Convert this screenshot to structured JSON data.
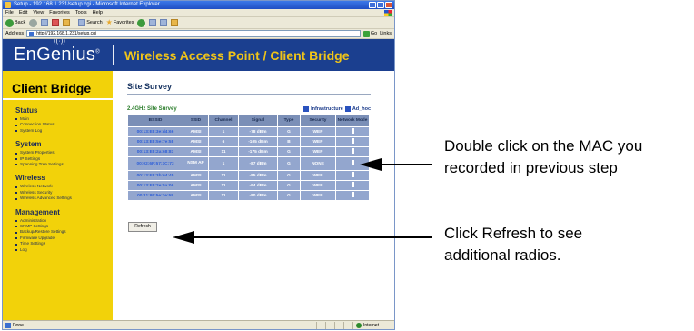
{
  "browser": {
    "title": "Setup - 192.168.1.231/setup.cgi - Microsoft Internet Explorer",
    "menu": [
      "File",
      "Edit",
      "View",
      "Favorites",
      "Tools",
      "Help"
    ],
    "toolbar": {
      "back": "Back",
      "search": "Search",
      "favorites": "Favorites"
    },
    "address_label": "Address",
    "address_value": "http://192.168.1.231/setup.cgi",
    "go_label": "Go",
    "links_label": "Links"
  },
  "header": {
    "brand": "EnGenius",
    "title": "Wireless Access Point / Client Bridge"
  },
  "sidebar": {
    "heading": "Client Bridge",
    "groups": [
      {
        "title": "Status",
        "items": [
          "Main",
          "Connection Status",
          "System Log"
        ]
      },
      {
        "title": "System",
        "items": [
          "System Properties",
          "IP Settings",
          "Spanning Tree Settings"
        ]
      },
      {
        "title": "Wireless",
        "items": [
          "Wireless Network",
          "Wireless Security",
          "Wireless Advanced Settings"
        ]
      },
      {
        "title": "Management",
        "items": [
          "Administration",
          "SNMP Settings",
          "Backup/Restore Settings",
          "Firmware Upgrade",
          "Time Settings",
          "Log"
        ]
      }
    ]
  },
  "main": {
    "title": "Site Survey",
    "survey_label": "2.4GHz Site Survey",
    "legend_infra": "Infrastructure",
    "legend_adhoc": "Ad_hoc",
    "columns": [
      "BSSID",
      "SSID",
      "Channel",
      "Signal",
      "Type",
      "Security",
      "Network Mode"
    ],
    "rows": [
      [
        "00:13:E8:3e:d4:66",
        "AMSI",
        "1",
        "-78 dBm",
        "G",
        "WEP",
        ""
      ],
      [
        "00:13:E8:5e:7e:58",
        "AMSI",
        "6",
        "-105 dBm",
        "B",
        "WEP",
        ""
      ],
      [
        "00:13:E8:2a:68:83",
        "AMSI",
        "11",
        "-175 dBm",
        "G",
        "WEP",
        ""
      ],
      [
        "00:02:6F:57:3C:73",
        "NSM AP",
        "1",
        "-87 dBm",
        "G",
        "NONE",
        ""
      ],
      [
        "00:13:E8:3b:64:45",
        "AMSI",
        "11",
        "-85 dBm",
        "G",
        "WEP",
        ""
      ],
      [
        "00:13:E8:2e:5a:06",
        "AMSI",
        "11",
        "-94 dBm",
        "G",
        "WEP",
        ""
      ],
      [
        "00:11:95:5e:7e:58",
        "AMSI",
        "11",
        "-80 dBm",
        "G",
        "WEP",
        ""
      ]
    ],
    "refresh_label": "Refresh"
  },
  "statusbar": {
    "text": "Done",
    "zone": "Internet"
  },
  "annotations": {
    "mac_line1": "Double click on the MAC you",
    "mac_line2": "recorded in previous step",
    "refresh_line1": "Click Refresh to see",
    "refresh_line2": "additional radios."
  },
  "colors": {
    "header_band": "#1b3f8f",
    "header_title": "#f0c419",
    "sidebar": "#f2d20a",
    "table_cell": "#93a6ce",
    "table_header": "#7b8fb7",
    "link": "#2e5fd8"
  }
}
